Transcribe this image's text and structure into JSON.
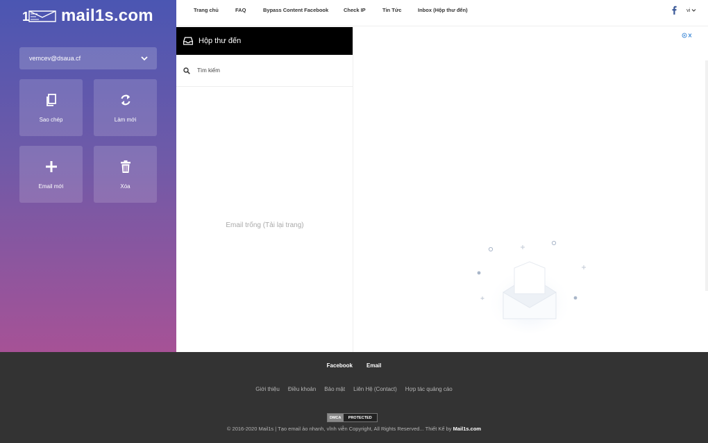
{
  "brand": {
    "name": "mail1s.com"
  },
  "sidebar": {
    "email": "vemcev@dsaua.cf",
    "actions": [
      {
        "label": "Sao chép",
        "icon": "copy-icon"
      },
      {
        "label": "Làm mới",
        "icon": "refresh-icon"
      },
      {
        "label": "Email mới",
        "icon": "plus-icon"
      },
      {
        "label": "Xóa",
        "icon": "trash-icon"
      }
    ]
  },
  "nav": {
    "items": [
      "Trang chủ",
      "FAQ",
      "Bypass Content Facebook",
      "Check IP",
      "Tin Tức",
      "Inbox (Hộp thư đến)"
    ],
    "lang": "vi"
  },
  "inbox": {
    "title": "Hộp thư đến",
    "search_placeholder": "Tìm kiếm",
    "empty_message": "Email trống (Tải lại trang)"
  },
  "footer": {
    "social": [
      "Facebook",
      "Email"
    ],
    "links": [
      "Giới thiệu",
      "Điều khoản",
      "Bảo mật",
      "Liên Hệ (Contact)",
      "Hợp tác quảng cáo"
    ],
    "dmca_left": "DMCA",
    "dmca_right": "PROTECTED",
    "copyright": "© 2016-2020 Mail1s | Tạo email ảo nhanh, vĩnh viễn Copyright, All Rights Reserved... Thiết Kế by ",
    "copyright_brand": "Mail1s.com"
  },
  "colors": {
    "sidebar_top": "#4b56b2",
    "sidebar_bottom": "#a65296",
    "footer_bg": "#333333",
    "inbox_header_bg": "#000000",
    "facebook_blue": "#3b5998"
  }
}
